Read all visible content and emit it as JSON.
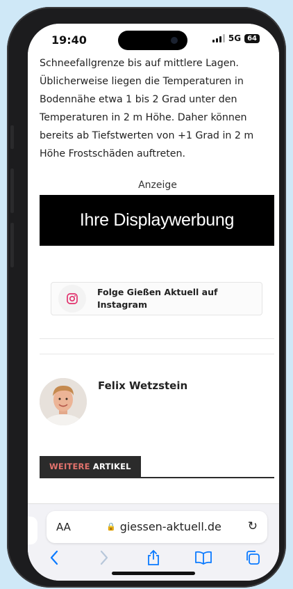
{
  "status": {
    "time": "19:40",
    "network": "5G",
    "battery": "64"
  },
  "article": {
    "lines": [
      "Schneefallgrenze bis auf mittlere Lagen.",
      "Üblicherweise liegen die Temperaturen in",
      "Bodennähe etwa 1 bis 2 Grad unter den",
      "Temperaturen in 2 m Höhe. Daher können",
      "bereits ab Tiefstwerten von +1 Grad in 2 m",
      "Höhe Frostschäden auftreten."
    ]
  },
  "ad": {
    "label": "Anzeige",
    "banner": "Ihre Displaywerbung"
  },
  "instagram": {
    "line1": "Folge Gießen Aktuell auf",
    "line2": "Instagram",
    "icon": "instagram-icon",
    "color": "#e1306c"
  },
  "author": {
    "name": "Felix Wetzstein"
  },
  "more": {
    "accent": "WEITERE",
    "label": " ARTIKEL",
    "accent_color": "#e4736d"
  },
  "safari": {
    "text_size_label": "AA",
    "url": "giessen-aktuell.de",
    "icons": [
      "back-icon",
      "forward-icon",
      "share-icon",
      "bookmarks-icon",
      "tabs-icon"
    ]
  }
}
